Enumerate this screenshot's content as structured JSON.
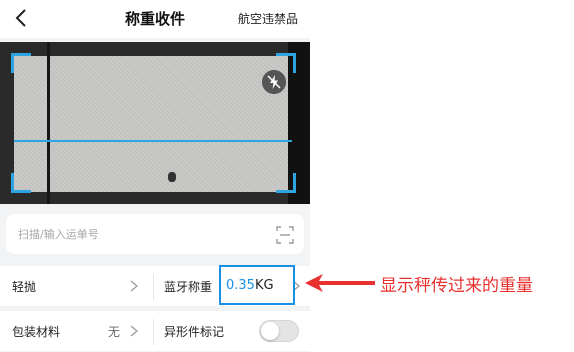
{
  "navbar": {
    "title": "称重收件",
    "right_link": "航空违禁品",
    "back_icon": "chevron-left-icon"
  },
  "camera": {
    "flash_icon": "flash-off-icon",
    "accent_color": "#2fa4e3"
  },
  "scan": {
    "placeholder": "扫描/输入运单号",
    "value": "",
    "scan_icon": "scan-frame-icon"
  },
  "form": {
    "row1": {
      "left_label": "轻抛",
      "right_label": "蓝牙称重",
      "weight_value": "0.35",
      "weight_unit": "KG"
    },
    "row2": {
      "left_label": "包装材料",
      "left_value": "无",
      "right_label": "异形件标记",
      "toggle_on": false
    }
  },
  "annotation": {
    "text": "显示秤传过来的重量",
    "color": "#e8312f",
    "highlight_color": "#1a8fe6"
  }
}
